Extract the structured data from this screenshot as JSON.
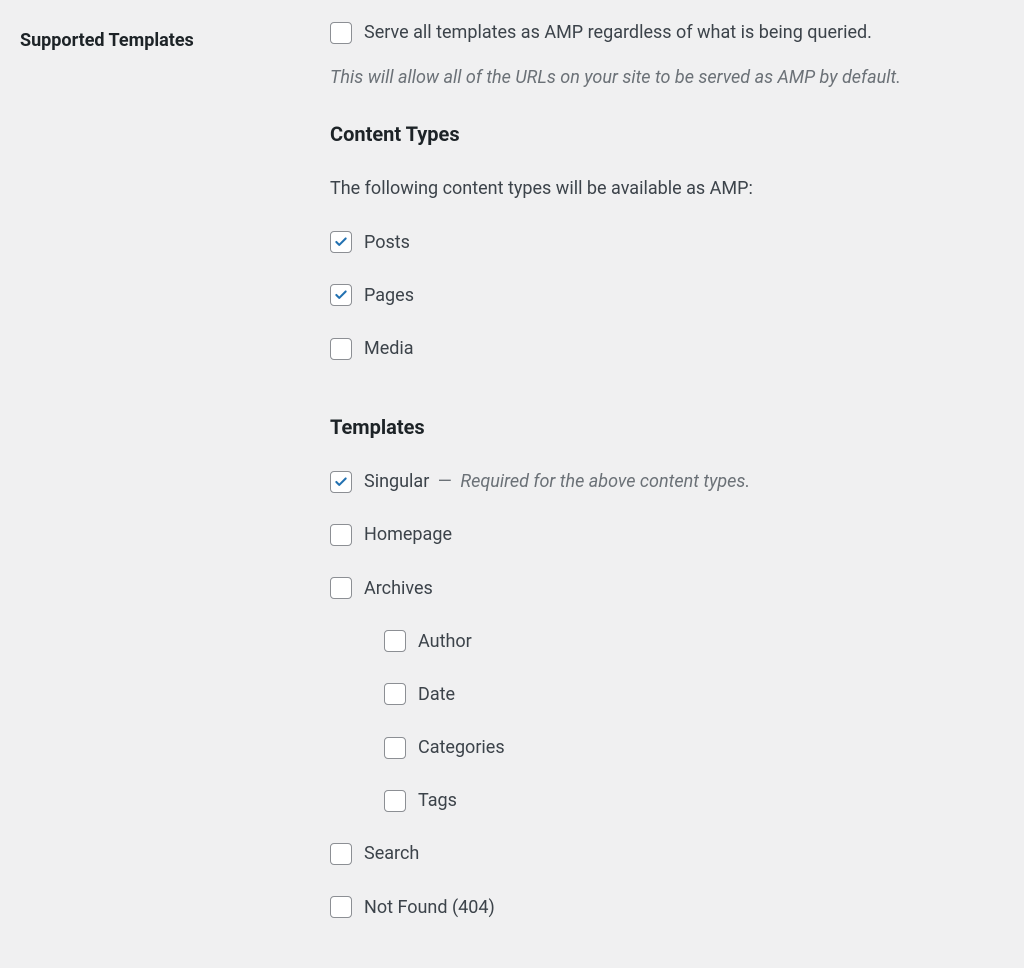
{
  "section_title": "Supported Templates",
  "serve_all": {
    "checked": false,
    "label": "Serve all templates as AMP regardless of what is being queried."
  },
  "description": "This will allow all of the URLs on your site to be served as AMP by default.",
  "content_types": {
    "heading": "Content Types",
    "intro": "The following content types will be available as AMP:",
    "items": [
      {
        "label": "Posts",
        "checked": true
      },
      {
        "label": "Pages",
        "checked": true
      },
      {
        "label": "Media",
        "checked": false
      }
    ]
  },
  "templates": {
    "heading": "Templates",
    "items": [
      {
        "label": "Singular",
        "checked": true,
        "dash": "—",
        "note": "Required for the above content types."
      },
      {
        "label": "Homepage",
        "checked": false
      },
      {
        "label": "Archives",
        "checked": false,
        "children": [
          {
            "label": "Author",
            "checked": false
          },
          {
            "label": "Date",
            "checked": false
          },
          {
            "label": "Categories",
            "checked": false
          },
          {
            "label": "Tags",
            "checked": false
          }
        ]
      },
      {
        "label": "Search",
        "checked": false
      },
      {
        "label": "Not Found (404)",
        "checked": false
      }
    ]
  }
}
